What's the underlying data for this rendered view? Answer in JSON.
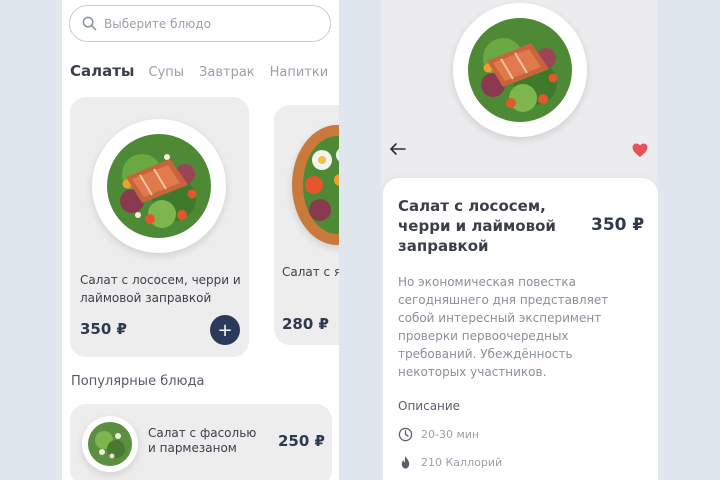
{
  "search": {
    "placeholder": "Выберите блюдо"
  },
  "categories": [
    {
      "label": "Салаты",
      "active": true
    },
    {
      "label": "Супы"
    },
    {
      "label": "Завтрак"
    },
    {
      "label": "Напитки"
    }
  ],
  "cards": [
    {
      "title": "Салат с лососем, черри и лаймовой заправкой",
      "price": "350 ₽",
      "add_label": "+"
    },
    {
      "title": "Салат с яйцом и",
      "price": "280 ₽"
    }
  ],
  "popular": {
    "title": "Популярные блюда",
    "items": [
      {
        "name": "Салат с фасолью и пармезаном",
        "price": "250 ₽"
      }
    ]
  },
  "detail": {
    "title": "Салат с лососем, черри и лаймовой заправкой",
    "price": "350 ₽",
    "description": "Но экономическая повестка сегодняшнего дня представляет собой интересный эксперимент проверки первоочередных требований. Убеждённость некоторых участников.",
    "section_label": "Описание",
    "cook_time": "20-30 мин",
    "calories": "210 Каллорий",
    "favorite_color": "#e8505b"
  },
  "theme": {
    "accent": "#2b3a5a",
    "background": "#dfe6ee"
  }
}
